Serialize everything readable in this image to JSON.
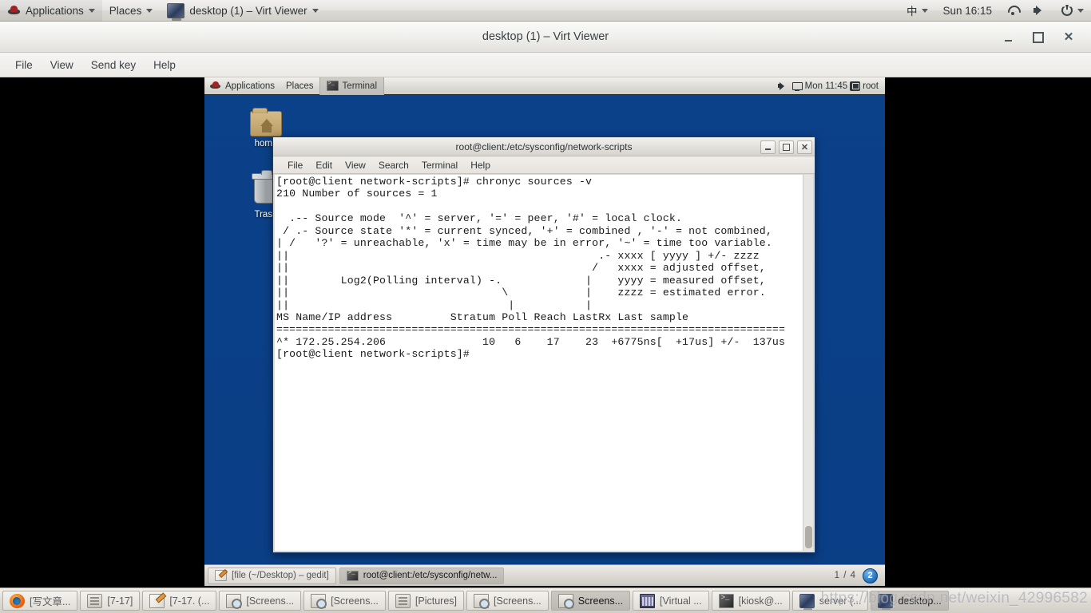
{
  "host_panel": {
    "applications_label": "Applications",
    "places_label": "Places",
    "window_label": "desktop (1) – Virt Viewer",
    "input_method": "中",
    "clock": "Sun 16:15",
    "icons": {
      "hat": "redhat-logo-icon",
      "network": "wifi-icon",
      "volume": "volume-muted-icon",
      "power": "power-icon"
    }
  },
  "virt_viewer": {
    "title": "desktop (1) – Virt Viewer",
    "menus": [
      "File",
      "View",
      "Send key",
      "Help"
    ],
    "window_buttons": {
      "minimize": "–",
      "maximize": "□",
      "close": "✕"
    }
  },
  "guest_panel": {
    "applications_label": "Applications",
    "places_label": "Places",
    "active_app": "Terminal",
    "clock": "Mon 11:45",
    "user": "root"
  },
  "desktop_icons": [
    {
      "label": "home",
      "icon": "home-folder-icon"
    },
    {
      "label": "Trash",
      "icon": "trash-icon"
    }
  ],
  "terminal": {
    "title": "root@client:/etc/sysconfig/network-scripts",
    "menus": [
      "File",
      "Edit",
      "View",
      "Search",
      "Terminal",
      "Help"
    ],
    "window_buttons": {
      "minimize": "–",
      "maximize": "□",
      "close": "✕"
    },
    "content": "[root@client network-scripts]# chronyc sources -v\n210 Number of sources = 1\n\n  .-- Source mode  '^' = server, '=' = peer, '#' = local clock.\n / .- Source state '*' = current synced, '+' = combined , '-' = not combined,\n| /   '?' = unreachable, 'x' = time may be in error, '~' = time too variable.\n||                                                .- xxxx [ yyyy ] +/- zzzz\n||                                               /   xxxx = adjusted offset,\n||        Log2(Polling interval) -.             |    yyyy = measured offset,\n||                                 \\            |    zzzz = estimated error.\n||                                  |           |\nMS Name/IP address         Stratum Poll Reach LastRx Last sample\n===============================================================================\n^* 172.25.254.206               10   6    17    23  +6775ns[  +17us] +/-  137us\n[root@client network-scripts]#"
  },
  "guest_taskbar": {
    "tasks": [
      {
        "label": "[file (~/Desktop) – gedit]",
        "icon": "gedit-icon",
        "active": false
      },
      {
        "label": "root@client:/etc/sysconfig/netw...",
        "icon": "terminal-icon",
        "active": true
      }
    ],
    "workspace_indicator": "1 / 4",
    "workspace_badge": "2"
  },
  "host_taskbar": {
    "tasks": [
      {
        "label": "[写文章...",
        "icon": "firefox-icon",
        "active": false
      },
      {
        "label": "[7-17]",
        "icon": "file-manager-icon",
        "active": false
      },
      {
        "label": "[7-17. (...",
        "icon": "gedit-icon",
        "active": false
      },
      {
        "label": "[Screens...",
        "icon": "screenshot-icon",
        "active": false
      },
      {
        "label": "[Screens...",
        "icon": "screenshot-icon",
        "active": false
      },
      {
        "label": "[Pictures]",
        "icon": "file-manager-icon",
        "active": false
      },
      {
        "label": "[Screens...",
        "icon": "screenshot-icon",
        "active": false
      },
      {
        "label": "Screens...",
        "icon": "screenshot-icon",
        "active": true
      },
      {
        "label": "[Virtual ...",
        "icon": "virtualbox-icon",
        "active": false
      },
      {
        "label": "[kiosk@...",
        "icon": "terminal-icon",
        "active": false
      },
      {
        "label": "server (...",
        "icon": "virt-viewer-icon",
        "active": false
      },
      {
        "label": "desktop...",
        "icon": "virt-viewer-icon",
        "active": true
      }
    ]
  },
  "watermark": {
    "text": "https://blog.csdn.net/weixin_42996582"
  },
  "colors": {
    "desktop_blue": "#0b4189",
    "panel_grey": "#dcdad5",
    "terminal_bg": "#ffffff",
    "terminal_fg": "#1a1a1a"
  }
}
